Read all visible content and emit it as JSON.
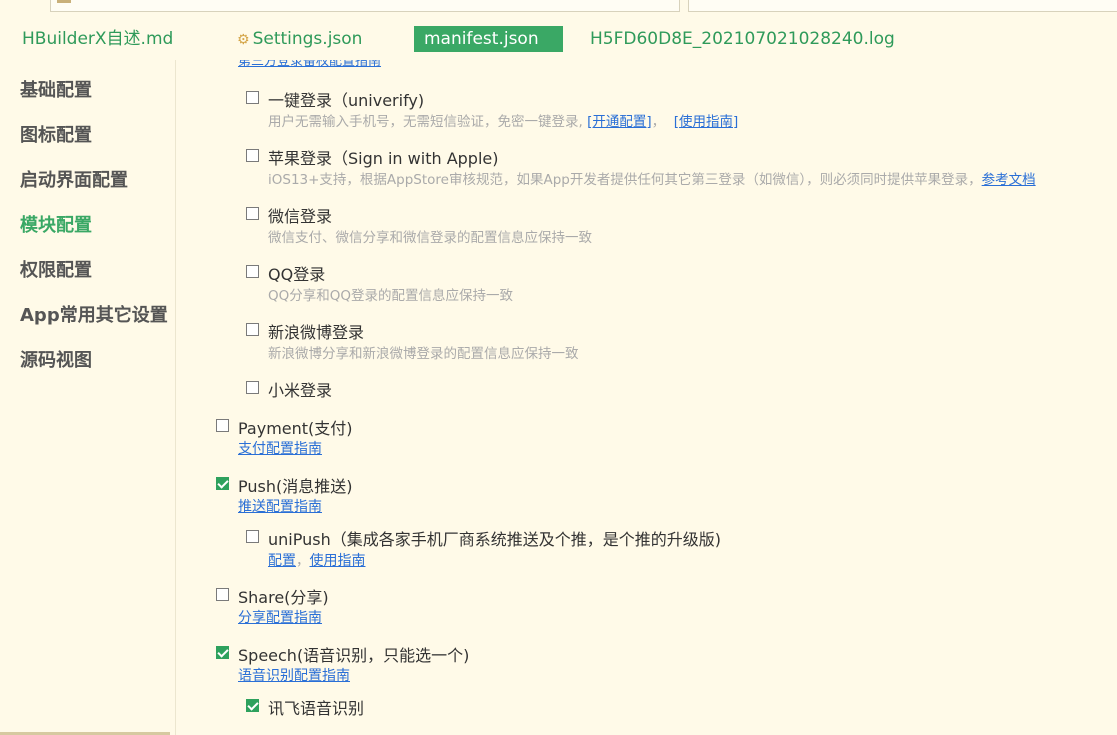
{
  "tabs": [
    {
      "label": "HBuilderX自述.md",
      "active": false
    },
    {
      "label": "Settings.json",
      "active": false,
      "icon": "gear-icon"
    },
    {
      "label": "manifest.json",
      "active": true
    },
    {
      "label": "H5FD60D8E_202107021028240.log",
      "active": false
    }
  ],
  "sidebar": {
    "items": [
      {
        "label": "基础配置"
      },
      {
        "label": "图标配置"
      },
      {
        "label": "启动界面配置"
      },
      {
        "label": "模块配置",
        "active": true
      },
      {
        "label": "权限配置"
      },
      {
        "label": "App常用其它设置"
      },
      {
        "label": "源码视图"
      }
    ]
  },
  "content": {
    "cut_link": "第三方登录备权配置指南",
    "univerify": {
      "label": "一键登录（univerify)",
      "checked": false,
      "desc": "用户无需输入手机号，无需短信验证，免密一键登录, ",
      "link1": "[开通配置]",
      "sep": "，",
      "link2": "[使用指南]"
    },
    "apple": {
      "label": "苹果登录（Sign in with Apple)",
      "checked": false,
      "desc": "iOS13+支持，根据AppStore审核规范，如果App开发者提供任何其它第三登录（如微信），则必须同时提供苹果登录，",
      "link": "参考文档"
    },
    "weixin": {
      "label": "微信登录",
      "checked": false,
      "desc": "微信支付、微信分享和微信登录的配置信息应保持一致"
    },
    "qq": {
      "label": "QQ登录",
      "checked": false,
      "desc": "QQ分享和QQ登录的配置信息应保持一致"
    },
    "sina": {
      "label": "新浪微博登录",
      "checked": false,
      "desc": "新浪微博分享和新浪微博登录的配置信息应保持一致"
    },
    "xiaomi": {
      "label": "小米登录",
      "checked": false
    },
    "payment": {
      "label": "Payment(支付)",
      "checked": false,
      "link": "支付配置指南"
    },
    "push": {
      "label": "Push(消息推送)",
      "checked": true,
      "link": "推送配置指南"
    },
    "unipush": {
      "label": "uniPush（集成各家手机厂商系统推送及个推，是个推的升级版)",
      "checked": false,
      "link1": "配置",
      "sep": "，",
      "link2": "使用指南"
    },
    "share": {
      "label": "Share(分享)",
      "checked": false,
      "link": "分享配置指南"
    },
    "speech": {
      "label": "Speech(语音识别，只能选一个)",
      "checked": true,
      "link": "语音识别配置指南"
    },
    "ifly": {
      "label": "讯飞语音识别",
      "checked": true
    }
  },
  "colors": {
    "background": "#fffae8",
    "accent": "#3aa865",
    "link": "#2a6fd6",
    "muted": "#aaaaaa"
  }
}
